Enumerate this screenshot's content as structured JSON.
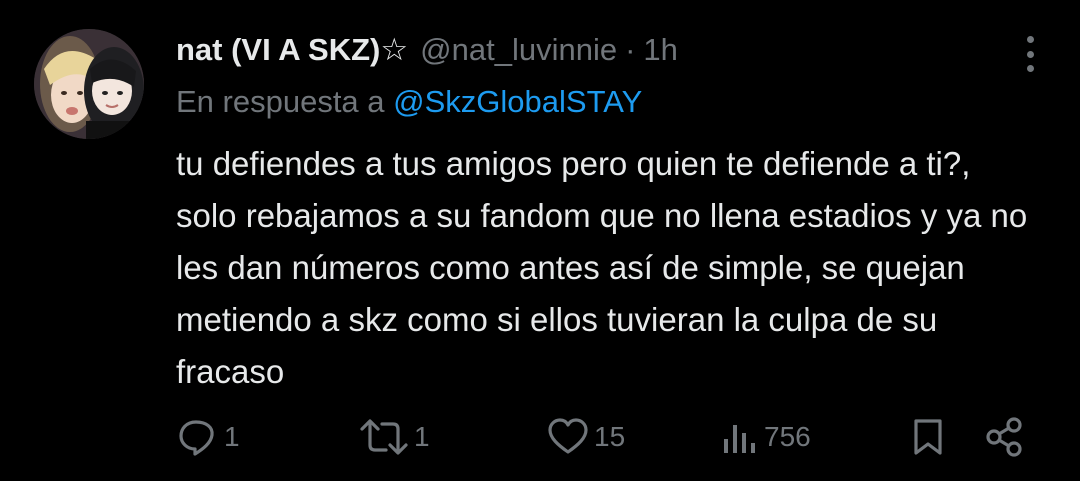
{
  "tweet": {
    "display_name": "nat (VI A SKZ)☆",
    "handle": "@nat_luvinnie",
    "separator": "·",
    "time": "1h",
    "reply_prefix": "En respuesta a",
    "reply_to": "@SkzGlobalSTAY",
    "text": "tu defiendes a tus amigos pero quien te defiende a ti?, solo rebajamos a su fandom que no llena estadios y ya no les dan números como antes así de simple, se quejan metiendo a skz como si ellos tuvieran la culpa de su fracaso"
  },
  "actions": {
    "reply_count": "1",
    "repost_count": "1",
    "like_count": "15",
    "views_count": "756"
  },
  "icons": {
    "reply": "reply-icon",
    "repost": "repost-icon",
    "like": "heart-icon",
    "views": "views-icon",
    "bookmark": "bookmark-icon",
    "share": "share-icon",
    "more": "more-vertical-icon"
  },
  "colors": {
    "background": "#000000",
    "primary_text": "#e7e9ea",
    "secondary_text": "#71767b",
    "link": "#1d9bf0"
  }
}
